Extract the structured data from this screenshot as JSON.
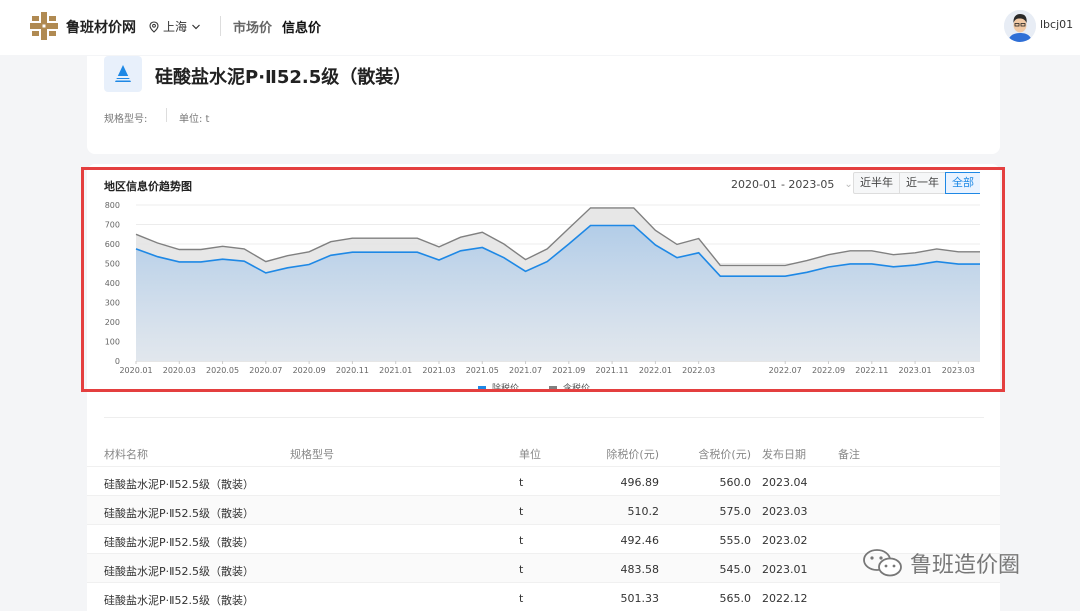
{
  "nav": {
    "logo_text": "鲁班材价网",
    "location": "上海",
    "menu_market": "市场价",
    "menu_info": "信息价",
    "username": "lbcj01"
  },
  "product": {
    "title": "硅酸盐水泥P·Ⅱ52.5级（散装）",
    "spec_label": "规格型号:",
    "unit_label": "单位:  t"
  },
  "chart_panel": {
    "title": "地区信息价趋势图",
    "date_start": "2020-01",
    "date_end": "- 2023-05",
    "ranges": [
      "近半年",
      "近一年",
      "全部"
    ],
    "active_range": "全部"
  },
  "chart_data": {
    "type": "area",
    "x": [
      "2020.01",
      "2020.02",
      "2020.03",
      "2020.04",
      "2020.05",
      "2020.06",
      "2020.07",
      "2020.08",
      "2020.09",
      "2020.10",
      "2020.11",
      "2020.12",
      "2021.01",
      "2021.02",
      "2021.03",
      "2021.04",
      "2021.05",
      "2021.06",
      "2021.07",
      "2021.08",
      "2021.09",
      "2021.10",
      "2021.11",
      "2021.12",
      "2022.01",
      "2022.02",
      "2022.03",
      "2022.04",
      "2022.05",
      "2022.06",
      "2022.07",
      "2022.08",
      "2022.09",
      "2022.10",
      "2022.11",
      "2022.12",
      "2023.01",
      "2023.02",
      "2023.03",
      "2023.04"
    ],
    "x_tick_labels": [
      "2020.01",
      "2020.03",
      "2020.05",
      "2020.07",
      "2020.09",
      "2020.11",
      "2021.01",
      "2021.03",
      "2021.05",
      "2021.07",
      "2021.09",
      "2021.11",
      "2022.01",
      "2022.03",
      "2022.07",
      "2022.09",
      "2022.11",
      "2023.01",
      "2023.03"
    ],
    "series": [
      {
        "name": "除税价",
        "color": "#1e88e5",
        "values": [
          575,
          535,
          508,
          508,
          522,
          512,
          452,
          478,
          495,
          542,
          558,
          558,
          558,
          558,
          518,
          565,
          582,
          530,
          460,
          510,
          600,
          695,
          695,
          695,
          595,
          530,
          555,
          435,
          435,
          435,
          435,
          455,
          482,
          498,
          498,
          483,
          492,
          510,
          497,
          497
        ]
      },
      {
        "name": "含税价",
        "color": "#808080",
        "values": [
          650,
          605,
          572,
          572,
          588,
          575,
          510,
          540,
          560,
          612,
          630,
          630,
          630,
          630,
          585,
          635,
          660,
          600,
          520,
          575,
          680,
          785,
          785,
          785,
          670,
          598,
          628,
          490,
          490,
          490,
          490,
          515,
          545,
          565,
          565,
          545,
          555,
          575,
          560,
          560
        ]
      }
    ],
    "ylim": [
      0,
      800
    ],
    "y_ticks": [
      0,
      100,
      200,
      300,
      400,
      500,
      600,
      700,
      800
    ],
    "grid": true,
    "legend": "bottom-center"
  },
  "table": {
    "headers": [
      "材料名称",
      "规格型号",
      "单位",
      "除税价(元)",
      "含税价(元)",
      "发布日期",
      "备注"
    ],
    "rows": [
      {
        "name": "硅酸盐水泥P·Ⅱ52.5级（散装）",
        "spec": "",
        "unit": "t",
        "ex_tax": "496.89",
        "in_tax": "560.0",
        "date": "2023.04",
        "note": ""
      },
      {
        "name": "硅酸盐水泥P·Ⅱ52.5级（散装）",
        "spec": "",
        "unit": "t",
        "ex_tax": "510.2",
        "in_tax": "575.0",
        "date": "2023.03",
        "note": ""
      },
      {
        "name": "硅酸盐水泥P·Ⅱ52.5级（散装）",
        "spec": "",
        "unit": "t",
        "ex_tax": "492.46",
        "in_tax": "555.0",
        "date": "2023.02",
        "note": ""
      },
      {
        "name": "硅酸盐水泥P·Ⅱ52.5级（散装）",
        "spec": "",
        "unit": "t",
        "ex_tax": "483.58",
        "in_tax": "545.0",
        "date": "2023.01",
        "note": ""
      },
      {
        "name": "硅酸盐水泥P·Ⅱ52.5级（散装）",
        "spec": "",
        "unit": "t",
        "ex_tax": "501.33",
        "in_tax": "565.0",
        "date": "2022.12",
        "note": ""
      }
    ]
  },
  "watermark": "鲁班造价圈"
}
